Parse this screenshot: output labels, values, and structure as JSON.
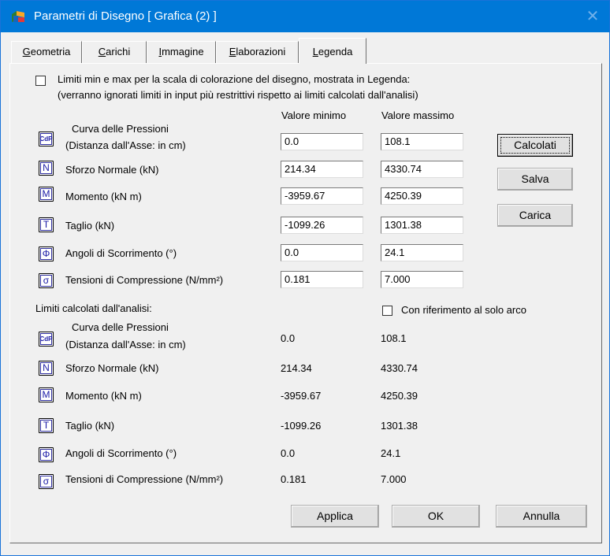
{
  "window": {
    "title": "Parametri di Disegno [ Grafica (2) ]"
  },
  "tabs": [
    {
      "mnemonic": "G",
      "rest": "eometria"
    },
    {
      "mnemonic": "C",
      "rest": "arichi"
    },
    {
      "mnemonic": "I",
      "rest": "mmagine"
    },
    {
      "mnemonic": "E",
      "rest": "laborazioni"
    },
    {
      "mnemonic": "L",
      "rest": "egenda"
    }
  ],
  "limits_checkbox": {
    "checked": false,
    "line1": "Limiti min e max per la scala di colorazione del disegno, mostrata in Legenda:",
    "line2": "(verranno ignorati limiti in input più restrittivi rispetto ai limiti calcolati dall'analisi)"
  },
  "columns": {
    "min": "Valore minimo",
    "max": "Valore massimo"
  },
  "symbols": {
    "cdp": "CdP",
    "n": "N",
    "m": "M",
    "t": "T",
    "phi": "Φ",
    "sigma": "σ"
  },
  "input_rows": [
    {
      "line1": "Curva delle Pressioni",
      "line2": "(Distanza dall'Asse: in cm)",
      "min": "0.0",
      "max": "108.1"
    },
    {
      "label": "Sforzo Normale (kN)",
      "min": "214.34",
      "max": "4330.74"
    },
    {
      "label": "Momento (kN m)",
      "min": "-3959.67",
      "max": "4250.39"
    },
    {
      "label": "Taglio (kN)",
      "min": "-1099.26",
      "max": "1301.38"
    },
    {
      "label": "Angoli di Scorrimento (°)",
      "min": "0.0",
      "max": "24.1"
    },
    {
      "label": "Tensioni di Compressione (N/mm²)",
      "min": "0.181",
      "max": "7.000"
    }
  ],
  "side_buttons": {
    "calcolati": "Calcolati",
    "salva": "Salva",
    "carica": "Carica"
  },
  "computed": {
    "header": "Limiti calcolati dall'analisi:",
    "arch_checkbox_label": "Con riferimento al solo arco",
    "arch_checked": false,
    "rows": [
      {
        "line1": "Curva delle Pressioni",
        "line2": "(Distanza dall'Asse: in cm)",
        "min": "0.0",
        "max": "108.1"
      },
      {
        "label": "Sforzo Normale (kN)",
        "min": "214.34",
        "max": "4330.74"
      },
      {
        "label": "Momento (kN m)",
        "min": "-3959.67",
        "max": "4250.39"
      },
      {
        "label": "Taglio (kN)",
        "min": "-1099.26",
        "max": "1301.38"
      },
      {
        "label": "Angoli di Scorrimento (°)",
        "min": "0.0",
        "max": "24.1"
      },
      {
        "label": "Tensioni di Compressione (N/mm²)",
        "min": "0.181",
        "max": "7.000"
      }
    ]
  },
  "footer_buttons": {
    "applica": "Applica",
    "ok": "OK",
    "annulla": "Annulla"
  }
}
